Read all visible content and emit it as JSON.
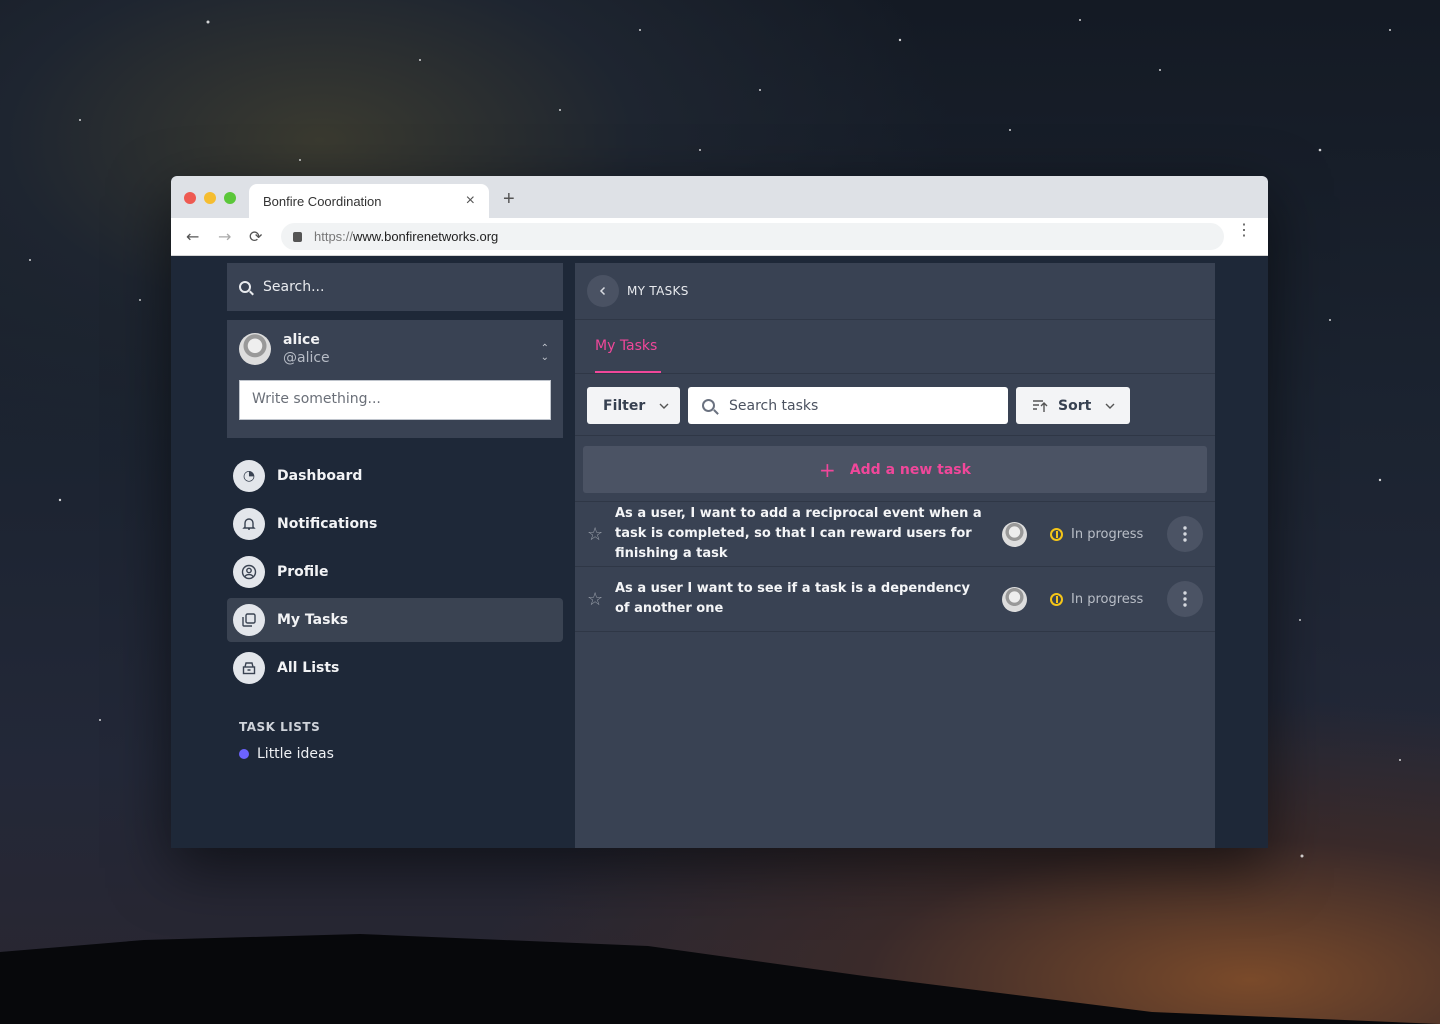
{
  "browser": {
    "tab_title": "Bonfire Coordination",
    "tab_close": "×",
    "new_tab": "+",
    "url_scheme": "https://",
    "url_host": "www.bonfirenetworks.org",
    "back": "←",
    "forward": "→",
    "reload": "⟳",
    "menu": "⋮"
  },
  "sidebar": {
    "search_placeholder": "Search...",
    "user": {
      "name": "alice",
      "handle": "@alice"
    },
    "composer_placeholder": "Write something...",
    "nav": [
      {
        "label": "Dashboard",
        "icon": "dashboard-icon",
        "glyph": "◔"
      },
      {
        "label": "Notifications",
        "icon": "bell-icon",
        "glyph": "🔔"
      },
      {
        "label": "Profile",
        "icon": "user-circle-icon",
        "glyph": "◉"
      },
      {
        "label": "My Tasks",
        "icon": "tasks-icon",
        "glyph": "❐"
      },
      {
        "label": "All Lists",
        "icon": "archive-icon",
        "glyph": "▤"
      }
    ],
    "task_lists_title": "TASK LISTS",
    "task_lists": [
      {
        "label": "Little ideas",
        "color": "#6c63ff"
      }
    ]
  },
  "main": {
    "header_title": "MY TASKS",
    "tab_label": "My Tasks",
    "filter_label": "Filter",
    "search_tasks_placeholder": "Search tasks",
    "sort_label": "Sort",
    "add_task_label": "Add a new task",
    "add_task_plus": "+",
    "tasks": [
      {
        "title": "As a user, I want to add a reciprocal event when a task is completed, so that I can reward users for finishing a task",
        "status": "In progress"
      },
      {
        "title": "As a user I want to see if a task is a dependency of another one",
        "status": "In progress"
      }
    ]
  },
  "colors": {
    "accent": "#f0479a",
    "status": "#f5c518",
    "list_dot": "#6c63ff"
  }
}
